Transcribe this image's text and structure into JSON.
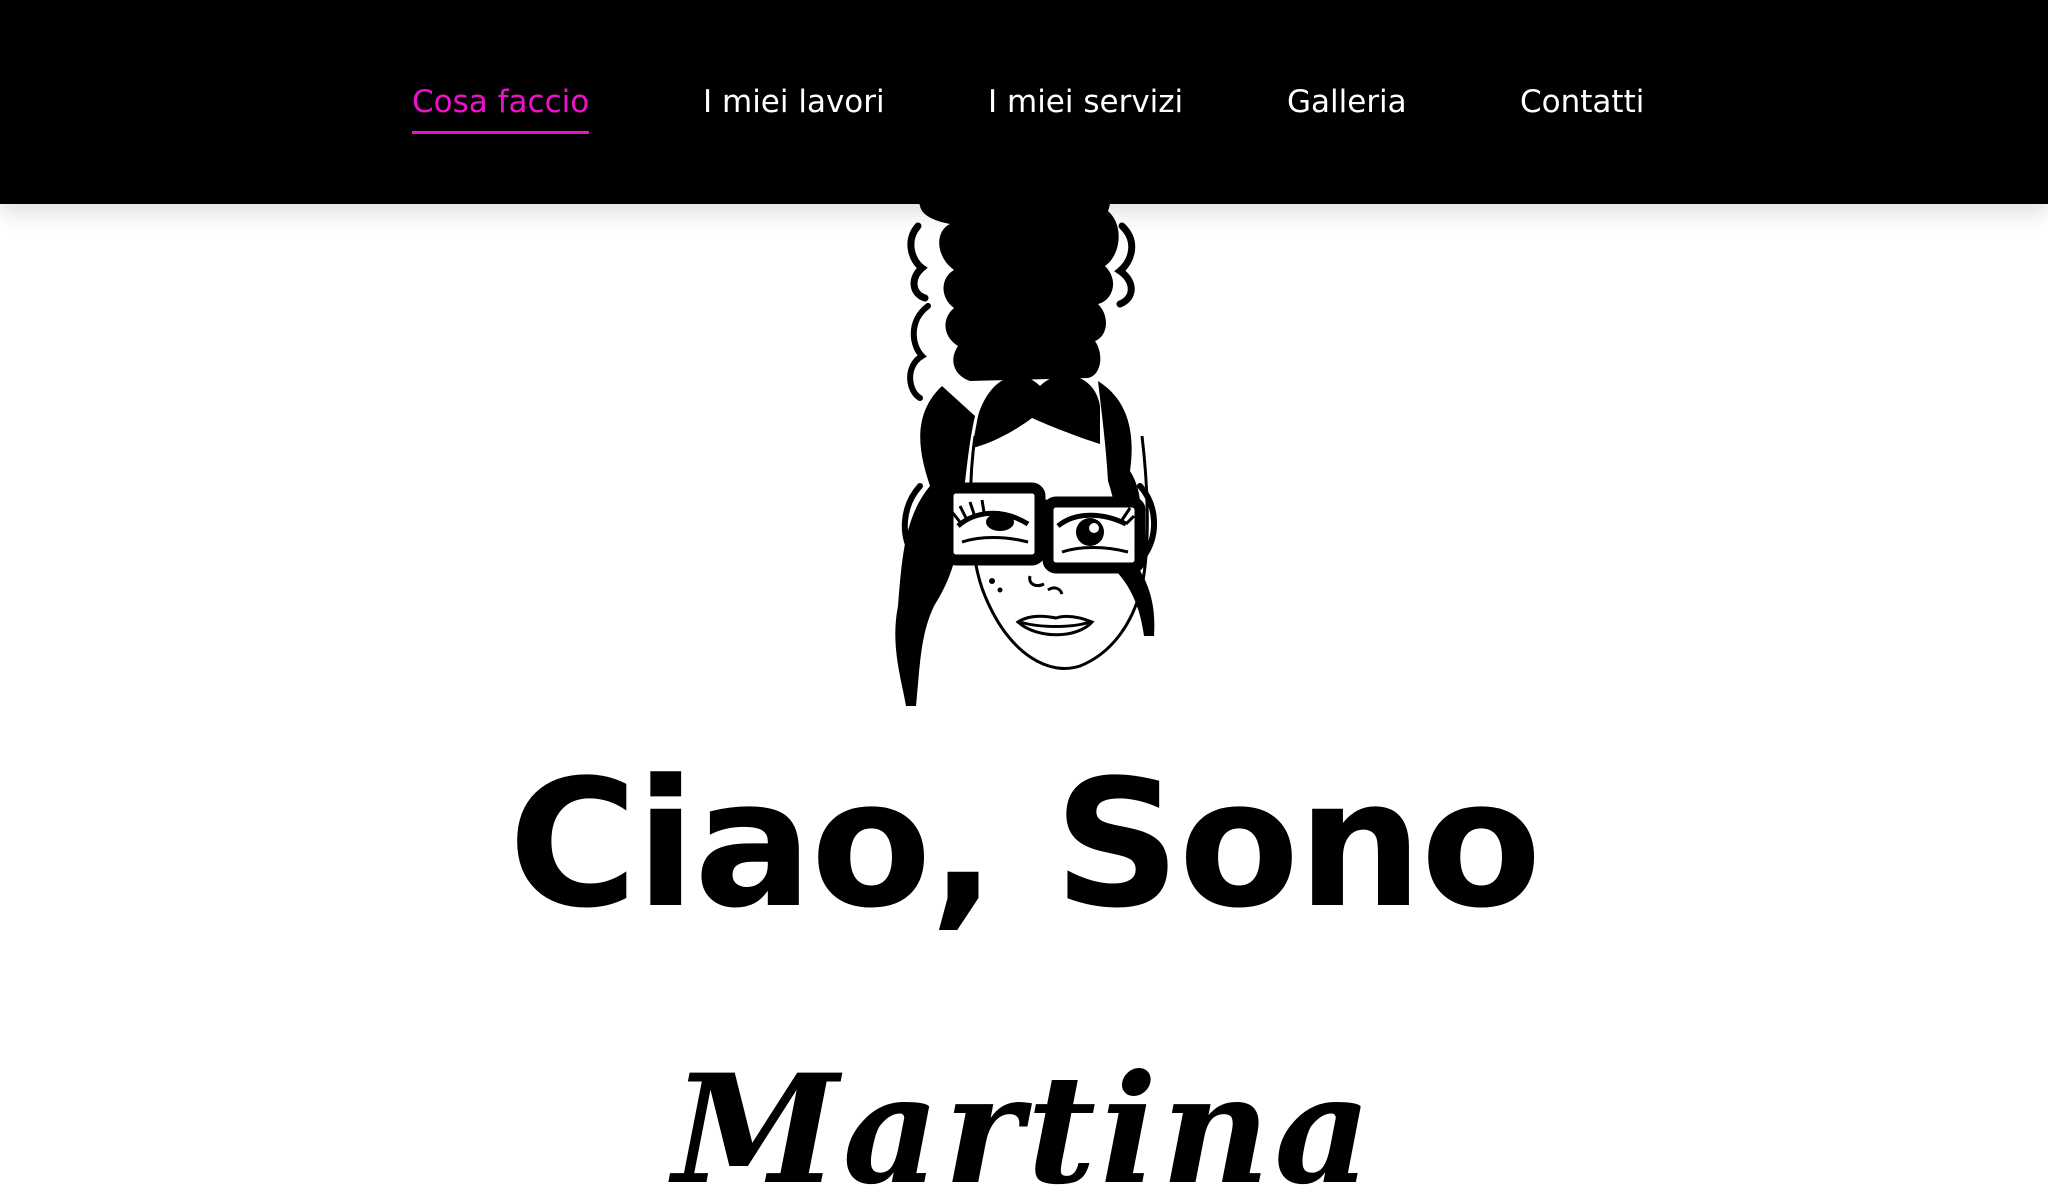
{
  "nav": {
    "items": [
      {
        "label": "Cosa faccio",
        "active": true
      },
      {
        "label": "I miei lavori",
        "active": false
      },
      {
        "label": "I miei servizi",
        "active": false
      },
      {
        "label": "Galleria",
        "active": false
      },
      {
        "label": "Contatti",
        "active": false
      }
    ]
  },
  "hero": {
    "headline": "Ciao, Sono",
    "name": "Martina",
    "avatar_icon": "woman-with-glasses-illustration"
  },
  "colors": {
    "accent": "#ee11cc",
    "nav_background": "#000000",
    "text": "#000000",
    "page_background": "#ffffff"
  }
}
